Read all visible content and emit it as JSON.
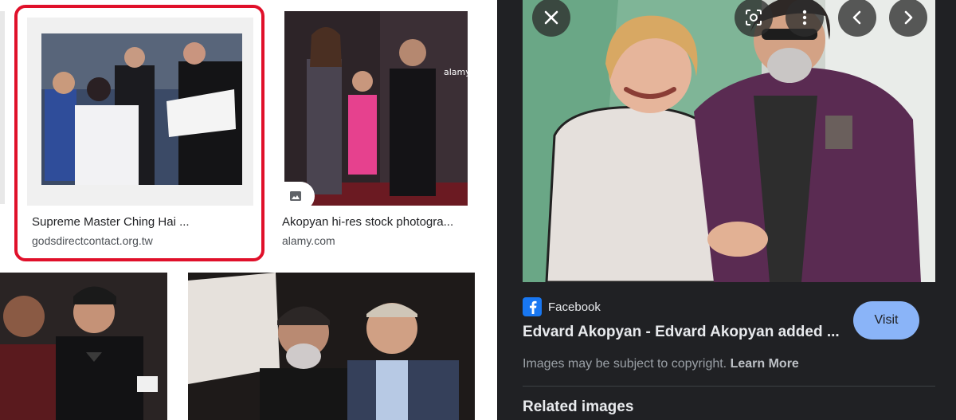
{
  "results": [
    {
      "title": "Supreme Master Ching Hai ...",
      "source": "godsdirectcontact.org.tw"
    },
    {
      "title": "Akopyan hi-res stock photogra...",
      "source": "alamy.com"
    }
  ],
  "panel": {
    "source_name": "Facebook",
    "title": "Edvard Akopyan - Edvard Akopyan added ...",
    "visit_label": "Visit",
    "copyright_text": "Images may be subject to copyright.",
    "learn_more_label": "Learn More",
    "related_heading": "Related images"
  },
  "colors": {
    "highlight": "#e0102a",
    "panel_bg": "#202124",
    "visit_bg": "#8ab4f8",
    "facebook": "#1877f2"
  },
  "icons": [
    "close-icon",
    "lens-icon",
    "more-vert-icon",
    "chevron-left-icon",
    "chevron-right-icon",
    "image-icon",
    "facebook-icon"
  ]
}
